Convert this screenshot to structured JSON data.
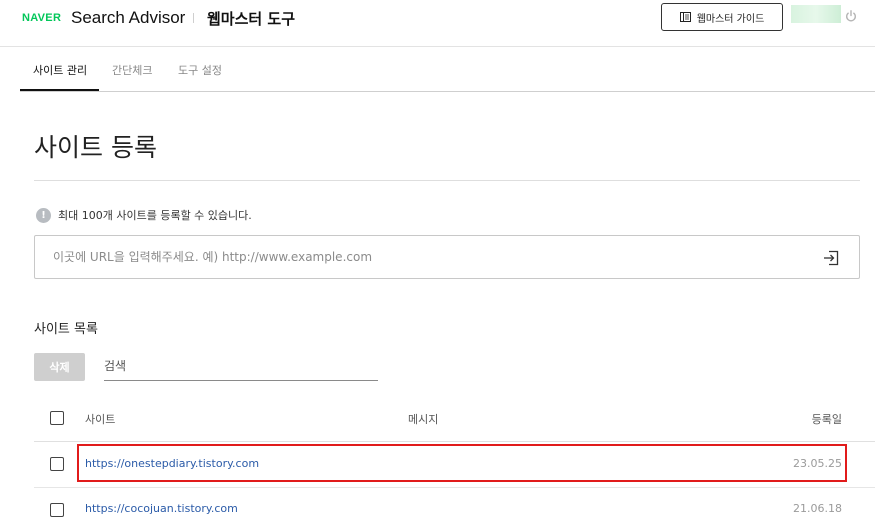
{
  "header": {
    "naver_logo": "NAVER",
    "product_name": "Search Advisor",
    "tool_name": "웹마스터 도구",
    "guide_button_label": "웹마스터 가이드"
  },
  "tabs": [
    {
      "label": "사이트 관리",
      "active": true
    },
    {
      "label": "간단체크",
      "active": false
    },
    {
      "label": "도구 설정",
      "active": false
    }
  ],
  "main": {
    "title": "사이트 등록",
    "notice": "최대 100개 사이트를 등록할 수 있습니다.",
    "url_input": {
      "value": "",
      "placeholder": "이곳에 URL을 입력해주세요. 예) http://www.example.com"
    },
    "list_title": "사이트 목록",
    "delete_button_label": "삭제",
    "search": {
      "value": "",
      "placeholder": "검색"
    }
  },
  "table": {
    "columns": [
      "사이트",
      "메시지",
      "등록일"
    ],
    "rows": [
      {
        "site": "https://onestepdiary.tistory.com",
        "message": "",
        "date": "23.05.25",
        "checked": false,
        "highlighted": true
      },
      {
        "site": "https://cocojuan.tistory.com",
        "message": "",
        "date": "21.06.18",
        "checked": false,
        "highlighted": false
      }
    ]
  },
  "colors": {
    "naver_green": "#03c75a",
    "link_blue": "#2b5ba8",
    "highlight_red": "#e11b1b",
    "disabled_gray": "#cfcfcf"
  },
  "icons": {
    "guide": "book-icon",
    "logout": "power-icon",
    "notice": "info-icon",
    "submit": "enter-icon"
  }
}
